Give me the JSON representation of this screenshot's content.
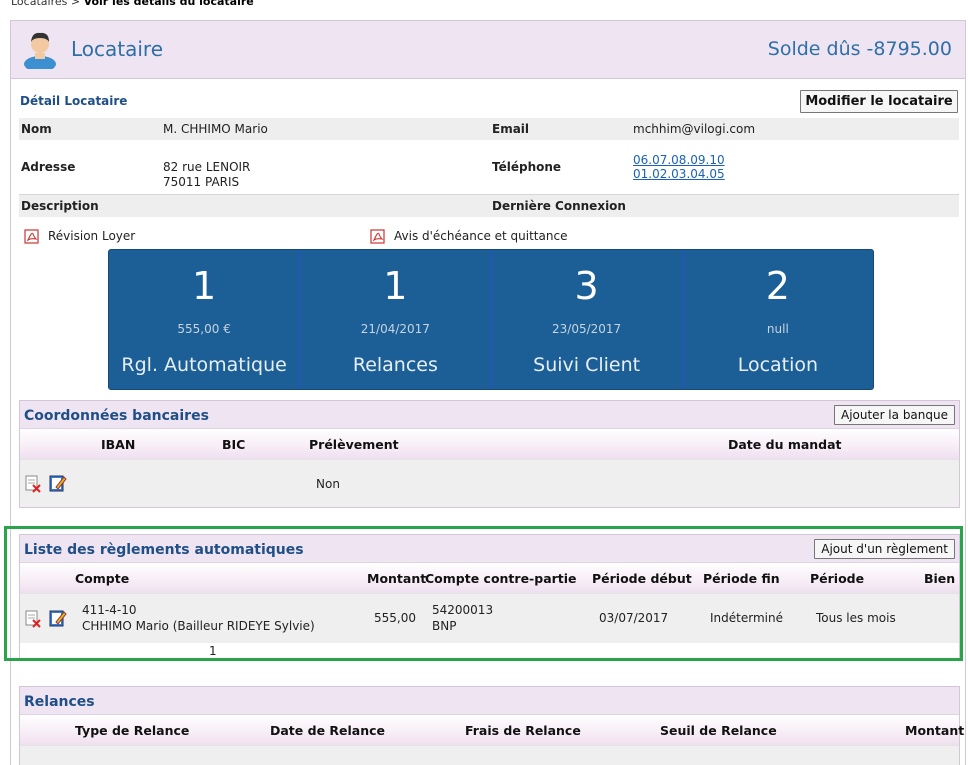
{
  "breadcrumb": {
    "parent": "Locataires",
    "sep": " > ",
    "current": "Voir les détails du locataire"
  },
  "header": {
    "title": "Locataire",
    "solde": "Solde dûs -8795.00"
  },
  "detail": {
    "title": "Détail Locataire",
    "modify_label": "Modifier le locataire",
    "nom_label": "Nom",
    "nom_value": "M. CHHIMO Mario",
    "email_label": "Email",
    "email_value": "mchhim@vilogi.com",
    "adresse_label": "Adresse",
    "adresse_line1": "82 rue LENOIR",
    "adresse_line2": "75011 PARIS",
    "telephone_label": "Téléphone",
    "telephone_1": "06.07.08.09.10",
    "telephone_2": "01.02.03.04.05",
    "description_label": "Description",
    "derniere_connexion_label": "Dernière Connexion"
  },
  "documents": {
    "revision": "Révision Loyer",
    "avis": "Avis d'échéance et quittance"
  },
  "stats": [
    {
      "num": "1",
      "sub": "555,00 €",
      "caption": "Rgl. Automatique"
    },
    {
      "num": "1",
      "sub": "21/04/2017",
      "caption": "Relances"
    },
    {
      "num": "3",
      "sub": "23/05/2017",
      "caption": "Suivi Client"
    },
    {
      "num": "2",
      "sub": "null",
      "caption": "Location"
    }
  ],
  "bank": {
    "title": "Coordonnées bancaires",
    "add_label": "Ajouter la banque",
    "cols": {
      "iban": "IBAN",
      "bic": "BIC",
      "prelevement": "Prélèvement",
      "date_mandat": "Date du mandat"
    },
    "row": {
      "prelevement": "Non"
    }
  },
  "reglements": {
    "title": "Liste des règlements automatiques",
    "add_label": "Ajout d'un règlement",
    "cols": {
      "compte": "Compte",
      "montant": "Montant",
      "contre_partie": "Compte contre-partie",
      "periode_debut": "Période début",
      "periode_fin": "Période fin",
      "periode": "Période",
      "bien": "Bien"
    },
    "row": {
      "compte_1": "411-4-10",
      "compte_2": "CHHIMO Mario (Bailleur RIDEYE Sylvie)",
      "montant": "555,00",
      "contre_1": "54200013",
      "contre_2": "BNP",
      "debut": "03/07/2017",
      "fin": "Indéterminé",
      "periode": "Tous les mois"
    },
    "pager": "1"
  },
  "relances": {
    "title": "Relances",
    "cols": {
      "type": "Type de Relance",
      "date": "Date de Relance",
      "frais": "Frais de Relance",
      "seuil": "Seuil de Relance",
      "montant": "Montant"
    }
  },
  "colors": {
    "accent": "#2f6fa8",
    "stats_bg": "#1b5f96",
    "highlight": "#2aa34a",
    "header_bg": "#efe4f1"
  }
}
